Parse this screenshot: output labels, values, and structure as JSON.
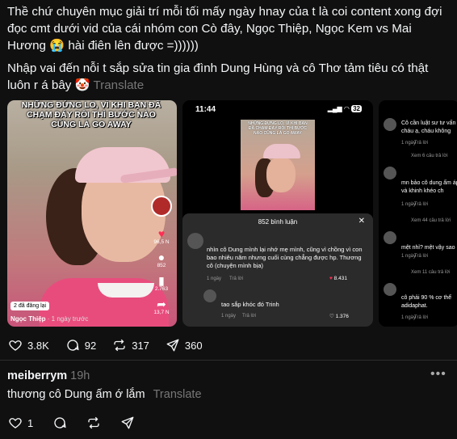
{
  "post": {
    "paragraph1": "Thề chứ chuyên mục giải trí mỗi tối mấy ngày hnay của t là coi content xong đợi đọc cmt dưới vid của cái nhóm con Cò đây, Ngọc Thiệp, Ngọc Kem vs Mai Hương 😭 hài điên lên được =))))))",
    "paragraph2": "Nhập vai đến nỗi t sắp sửa tin gia đình Dung Hùng và cô Thơ tảm tiêu có thật luôn r á bây 🤡",
    "translate": "Translate"
  },
  "video1": {
    "caption": "NHỮNG ĐỨNG LO, VÌ KHI BẠN ĐÃ CHẠM ĐÁY RỒI THÌ BƯỚC NÀO CŨNG LÀ GO AWAY",
    "likes": "96,5 N",
    "comments": "852",
    "saves": "2.763",
    "shares": "13,7 N",
    "tagged": "2 đã đăng lại",
    "username": "Ngọc Thiệp",
    "time": "· 1 ngày trước"
  },
  "video2": {
    "clock": "11:44",
    "battery": "32",
    "mini_caption": "NHỮNG ĐỨNG LO, VÌ KHI BẠN ĐÃ CHẠM ĐÁY RỒI THÌ BƯỚC NÀO CŨNG LÀ GO AWAY",
    "sheet_title": "852 bình luận",
    "comment1": "nhìn cô Dung mình lại nhớ mẹ mình, cũng vì chồng vì con bao nhiêu năm nhưng cuối cùng chẳng được hp. Thương cô (chuyện mình bịa)",
    "comment1_meta": "1 ngày",
    "comment1_reply": "Trả lời",
    "comment1_likes": "8.431",
    "comment2": "tao sắp khóc đó Trinh",
    "comment2_meta": "1 ngày",
    "comment2_reply": "Trả lời",
    "comment2_likes": "1.376"
  },
  "video3": {
    "c1": "Cô cần luật sư tư vấn cháu ạ, cháu không",
    "c1_meta": "1 ngày",
    "c1_reply": "Trả lời",
    "c1_more": "Xem 6 câu trả lời",
    "c2": "mn bảo cô dung ấm áp và khinh khéo ch",
    "c2_meta": "1 ngày",
    "c2_reply": "Trả lời",
    "c2_more": "Xem 44 câu trả lời",
    "c3": "mệt nhỉ? mệt vậy sao",
    "c3_meta": "1 ngày",
    "c3_reply": "Trả lời",
    "c3_more": "Xem 11 câu trả lời",
    "c4": "cô phải 90 % cơ thể adidaphat.",
    "c4_meta": "1 ngày",
    "c4_reply": "Trả lời"
  },
  "actions": {
    "likes": "3.8K",
    "comments": "92",
    "reposts": "317",
    "shares": "360"
  },
  "reply": {
    "username": "meiberrym",
    "time": "19h",
    "text": "thương cô Dung ấm ớ lắm",
    "translate": "Translate",
    "likes": "1"
  },
  "icons": {
    "heart": "heart-icon",
    "comment": "comment-icon",
    "repost": "repost-icon",
    "share": "share-icon",
    "more": "more-icon"
  }
}
